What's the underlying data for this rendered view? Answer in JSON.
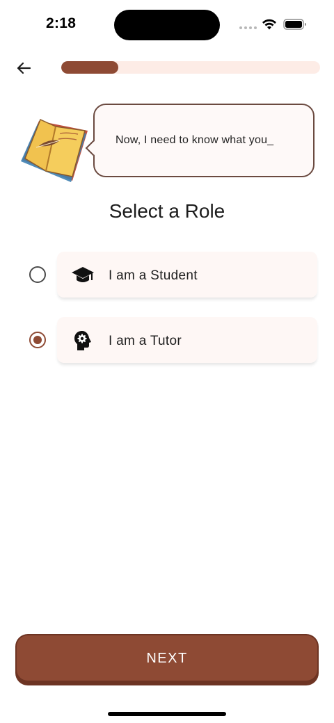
{
  "status_bar": {
    "time": "2:18"
  },
  "header": {
    "back_icon": "arrow-left-icon",
    "progress_fraction": 0.22
  },
  "mascot": {
    "icon": "open-book-mascot",
    "speech_text": "Now, I need to know what you_"
  },
  "title": "Select a Role",
  "roles": [
    {
      "label": "I am a Student",
      "icon": "graduation-cap-icon",
      "selected": false
    },
    {
      "label": "I am a Tutor",
      "icon": "head-gear-icon",
      "selected": true
    }
  ],
  "next_button": {
    "label": "NEXT"
  },
  "colors": {
    "accent": "#8e4a34",
    "progress_track": "#fdece6",
    "card_background": "#fef7f5",
    "bubble_border": "#6b4a40"
  }
}
